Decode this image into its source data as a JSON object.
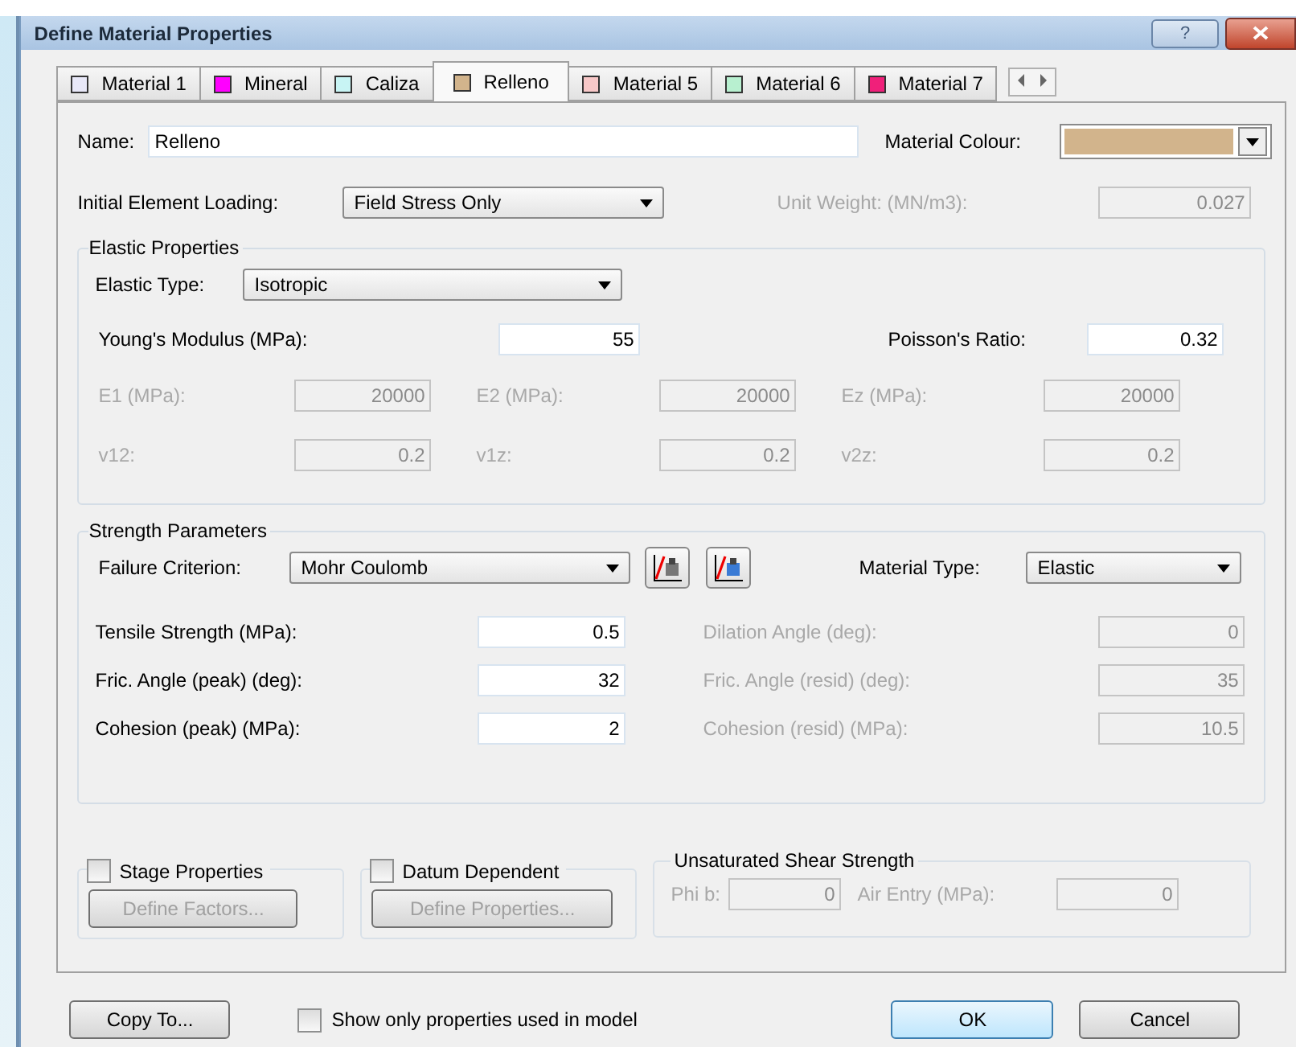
{
  "window": {
    "title": "Define Material Properties",
    "help": "?"
  },
  "tabs": [
    {
      "label": "Material 1",
      "color": "#e8e8f8",
      "selected": false
    },
    {
      "label": "Mineral",
      "color": "#ff00ff",
      "selected": false
    },
    {
      "label": "Caliza",
      "color": "#c8f4f4",
      "selected": false
    },
    {
      "label": "Relleno",
      "color": "#d2b48c",
      "selected": true
    },
    {
      "label": "Material 5",
      "color": "#f8c8c8",
      "selected": false
    },
    {
      "label": "Material 6",
      "color": "#b8f0d0",
      "selected": false
    },
    {
      "label": "Material 7",
      "color": "#f0207a",
      "selected": false
    }
  ],
  "name": {
    "label": "Name:",
    "value": "Relleno"
  },
  "material_colour": {
    "label": "Material Colour:",
    "color": "#d2b48c"
  },
  "initial_loading": {
    "label": "Initial Element Loading:",
    "value": "Field Stress Only"
  },
  "unit_weight": {
    "label": "Unit Weight: (MN/m3):",
    "value": "0.027",
    "disabled": true
  },
  "elastic": {
    "title": "Elastic Properties",
    "type_label": "Elastic Type:",
    "type_value": "Isotropic",
    "youngs": {
      "label": "Young's Modulus (MPa):",
      "value": "55",
      "disabled": false
    },
    "poisson": {
      "label": "Poisson's Ratio:",
      "value": "0.32",
      "disabled": false
    },
    "rows": [
      [
        {
          "label": "E1 (MPa):",
          "value": "20000",
          "disabled": true
        },
        {
          "label": "E2 (MPa):",
          "value": "20000",
          "disabled": true
        },
        {
          "label": "Ez (MPa):",
          "value": "20000",
          "disabled": true
        }
      ],
      [
        {
          "label": "v12:",
          "value": "0.2",
          "disabled": true
        },
        {
          "label": "v1z:",
          "value": "0.2",
          "disabled": true
        },
        {
          "label": "v2z:",
          "value": "0.2",
          "disabled": true
        }
      ]
    ]
  },
  "strength": {
    "title": "Strength Parameters",
    "criterion_label": "Failure Criterion:",
    "criterion_value": "Mohr Coulomb",
    "material_type_label": "Material Type:",
    "material_type_value": "Elastic",
    "rows": [
      [
        {
          "label": "Tensile Strength (MPa):",
          "value": "0.5",
          "disabled": false
        },
        {
          "label": "Dilation Angle (deg):",
          "value": "0",
          "disabled": true
        }
      ],
      [
        {
          "label": "Fric. Angle (peak) (deg):",
          "value": "32",
          "disabled": false
        },
        {
          "label": "Fric. Angle (resid) (deg):",
          "value": "35",
          "disabled": true
        }
      ],
      [
        {
          "label": "Cohesion (peak) (MPa):",
          "value": "2",
          "disabled": false
        },
        {
          "label": "Cohesion (resid) (MPa):",
          "value": "10.5",
          "disabled": true
        }
      ]
    ]
  },
  "stage": {
    "label": "Stage Properties",
    "checked": false,
    "button": "Define Factors...",
    "disabled": true
  },
  "datum": {
    "label": "Datum Dependent",
    "checked": false,
    "button": "Define Properties...",
    "disabled": true
  },
  "unsaturated": {
    "title": "Unsaturated Shear Strength",
    "fields": [
      {
        "label": "Phi b:",
        "value": "0",
        "disabled": true
      },
      {
        "label": "Air Entry (MPa):",
        "value": "0",
        "disabled": true
      }
    ]
  },
  "footer": {
    "copy": "Copy To...",
    "show_only": {
      "label": "Show only properties used in model",
      "checked": false
    },
    "ok": "OK",
    "cancel": "Cancel"
  }
}
